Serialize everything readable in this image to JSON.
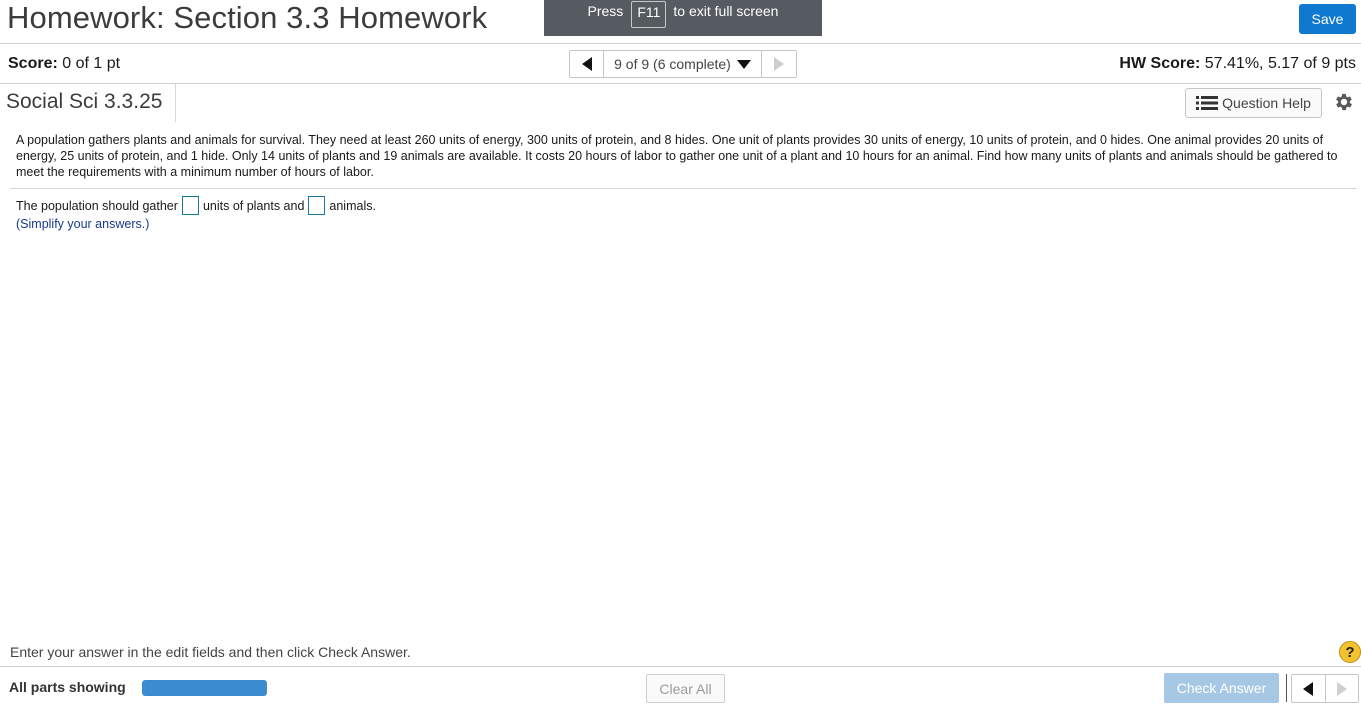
{
  "header": {
    "title": "Homework: Section 3.3 Homework",
    "fullscreen": {
      "press": "Press",
      "key": "F11",
      "rest": "to exit full screen"
    },
    "save_label": "Save"
  },
  "scorebar": {
    "score_label": "Score:",
    "score_value": "0 of 1 pt",
    "nav_text": "9 of 9 (6 complete)",
    "hw_label": "HW Score:",
    "hw_value": "57.41%, 5.17 of 9 pts"
  },
  "question_header": {
    "id": "Social Sci 3.3.25",
    "help_label": "Question Help"
  },
  "question": {
    "text": "A population gathers plants and animals for survival. They need at least 260 units of energy, 300 units of protein, and 8 hides. One unit of plants provides 30 units of energy, 10 units of protein, and 0 hides. One animal provides 20 units of energy, 25 units of protein, and 1 hide. Only 14 units of plants and 19 animals are available. It costs 20 hours of labor to gather one unit of a plant and 10 hours for an animal. Find how many units of plants and animals should be gathered to meet the requirements with a minimum number of hours of labor.",
    "answer_part1": "The population should gather",
    "answer_part2": "units of plants and",
    "answer_part3": "animals.",
    "answer_plants_value": "",
    "answer_animals_value": "",
    "simplify": "(Simplify your answers.)"
  },
  "footer": {
    "instruction": "Enter your answer in the edit fields and then click Check Answer.",
    "help_glyph": "?",
    "all_parts": "All parts showing",
    "progress_fraction": 1.0,
    "clear_all": "Clear All",
    "check_answer": "Check Answer"
  },
  "colors": {
    "accent": "#0f79d0",
    "banner": "#555b61",
    "check_disabled": "#a7c8e4",
    "progress": "#3b8bd0",
    "help": "#f2c230"
  }
}
